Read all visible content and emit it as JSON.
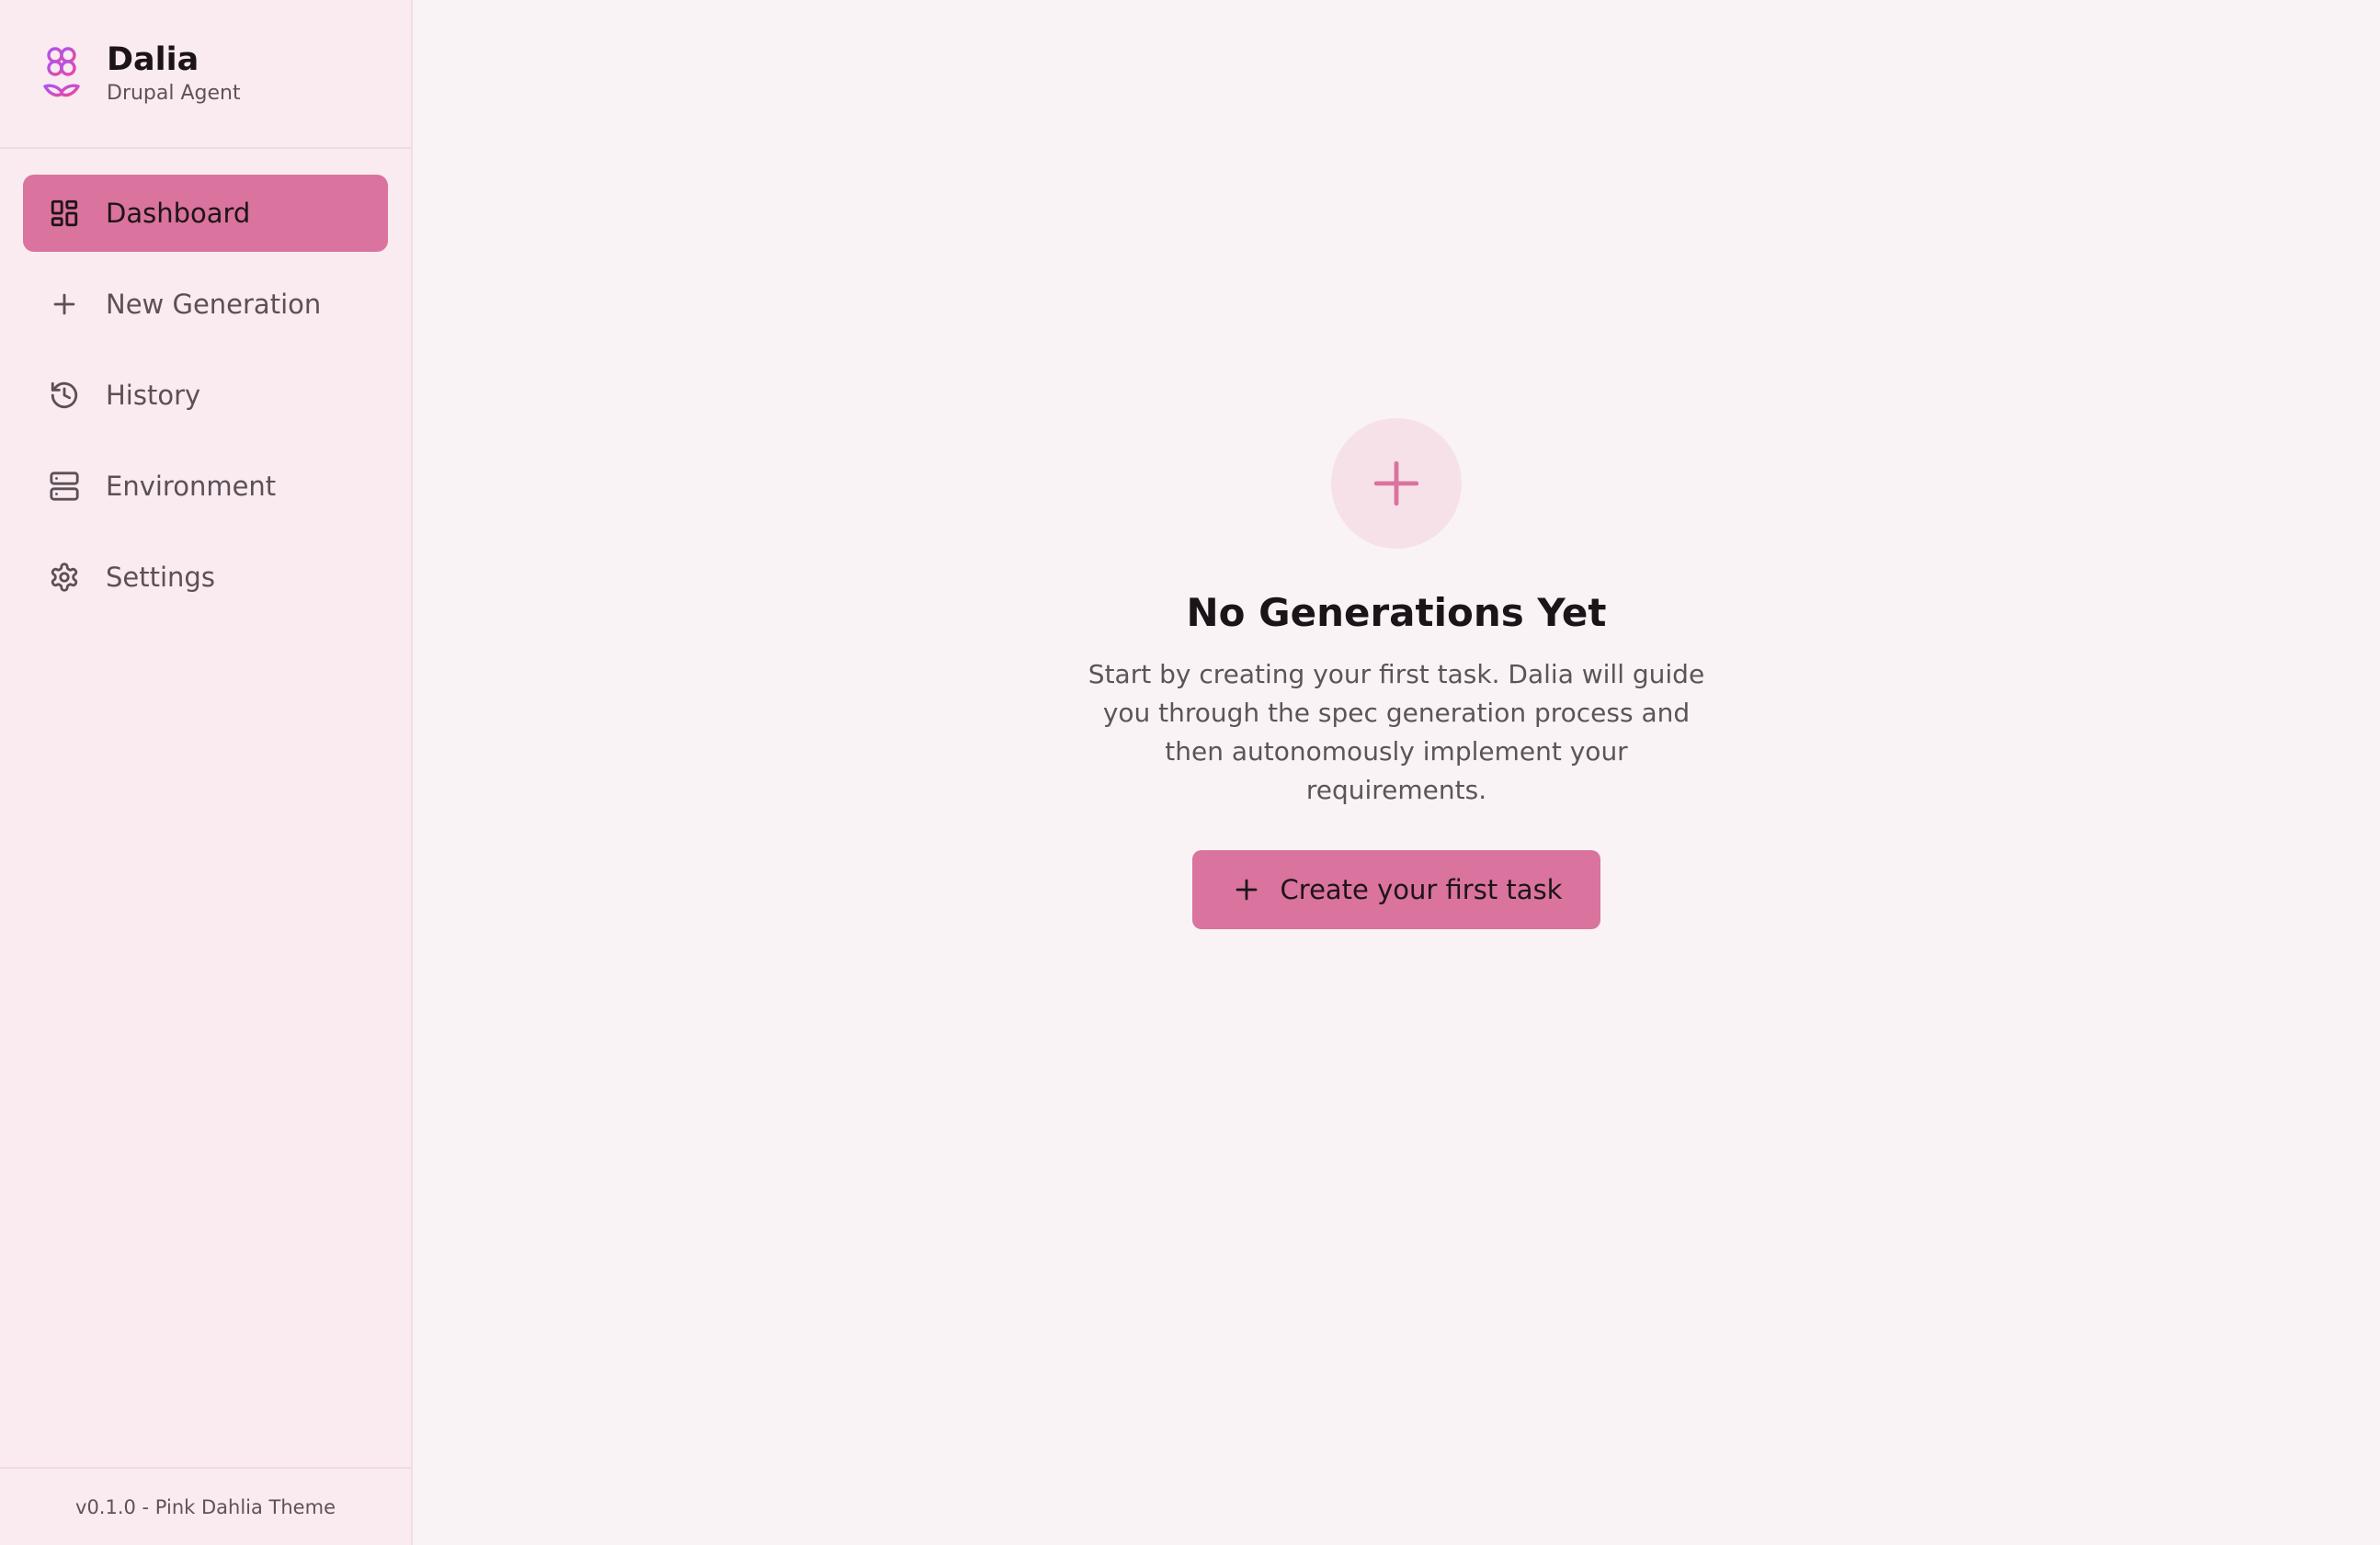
{
  "brand": {
    "title": "Dalia",
    "subtitle": "Drupal Agent",
    "logo_icon": "dahlia-flower-icon"
  },
  "sidebar": {
    "items": [
      {
        "label": "Dashboard",
        "icon": "dashboard-grid-icon",
        "active": true
      },
      {
        "label": "New Generation",
        "icon": "plus-icon",
        "active": false
      },
      {
        "label": "History",
        "icon": "history-clock-icon",
        "active": false
      },
      {
        "label": "Environment",
        "icon": "server-icon",
        "active": false
      },
      {
        "label": "Settings",
        "icon": "gear-icon",
        "active": false
      }
    ],
    "footer": "v0.1.0 - Pink Dahlia Theme"
  },
  "main": {
    "empty_state": {
      "icon": "plus-icon",
      "title": "No Generations Yet",
      "description": "Start by creating your first task. Dalia will guide you through the spec generation process and then autonomously implement your requirements.",
      "cta_label": "Create your first task",
      "cta_icon": "plus-icon"
    }
  },
  "colors": {
    "accent": "#da739d",
    "background": "#faf3f5",
    "sidebar_background": "#f9ebef",
    "empty_icon_background": "#f6e1e8",
    "logo_purple": "#a855f7",
    "logo_pink": "#ec4899"
  }
}
